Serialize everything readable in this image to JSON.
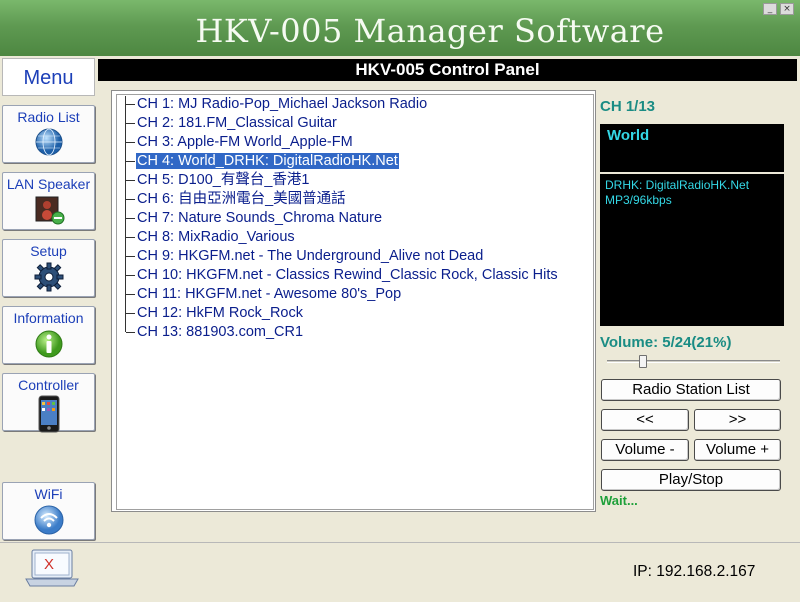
{
  "window": {
    "title": "HKV-005 Manager Software",
    "minimize_glyph": "_",
    "close_glyph": "×"
  },
  "menu": {
    "header": "Menu",
    "items": [
      {
        "label": "Radio List",
        "icon": "globe-icon"
      },
      {
        "label": "LAN Speaker",
        "icon": "speaker-icon"
      },
      {
        "label": "Setup",
        "icon": "gear-icon"
      },
      {
        "label": "Information",
        "icon": "info-icon"
      },
      {
        "label": "Controller",
        "icon": "phone-icon"
      },
      {
        "label": "WiFi",
        "icon": "wifi-icon"
      }
    ]
  },
  "panel": {
    "title": "HKV-005 Control Panel"
  },
  "channels": {
    "selected_index": 3,
    "items": [
      "CH 1: MJ Radio-Pop_Michael Jackson Radio",
      "CH 2: 181.FM_Classical Guitar",
      "CH 3: Apple-FM World_Apple-FM",
      "CH 4: World_DRHK: DigitalRadioHK.Net",
      "CH 5: D100_有聲台_香港1",
      "CH 6: 自由亞洲電台_美國普通話",
      "CH 7: Nature Sounds_Chroma Nature",
      "CH 8: MixRadio_Various",
      "CH 9: HKGFM.net - The Underground_Alive not Dead",
      "CH 10: HKGFM.net - Classics Rewind_Classic Rock, Classic Hits",
      "CH 11: HKGFM.net - Awesome 80's_Pop",
      "CH 12: HkFM Rock_Rock",
      "CH 13: 881903.com_CR1"
    ]
  },
  "player": {
    "channel_index": "CH 1/13",
    "station_name": "World",
    "info_line1": "DRHK: DigitalRadioHK.Net",
    "info_line2": "MP3/96kbps",
    "volume_label": "Volume:  5/24(21%)",
    "volume_fraction": 0.21,
    "status": "Wait..."
  },
  "controls": {
    "station_list": "Radio Station List",
    "prev": "<<",
    "next": ">>",
    "vol_down": "Volume -",
    "vol_up": "Volume +",
    "play_stop": "Play/Stop"
  },
  "footer": {
    "laptop_mark": "X",
    "ip": "IP: 192.168.2.167"
  },
  "colors": {
    "title_green": "#5f9a52",
    "accent_teal": "#1a8c84",
    "screen_text": "#34d8e6",
    "selection": "#3168c6",
    "status_green": "#1ea03a"
  }
}
